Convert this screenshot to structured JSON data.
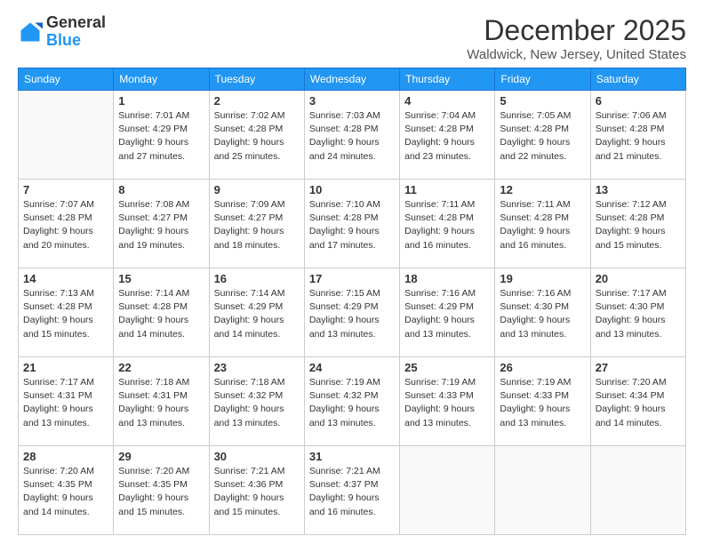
{
  "header": {
    "logo": {
      "line1": "General",
      "line2": "Blue"
    },
    "title": "December 2025",
    "location": "Waldwick, New Jersey, United States"
  },
  "days_of_week": [
    "Sunday",
    "Monday",
    "Tuesday",
    "Wednesday",
    "Thursday",
    "Friday",
    "Saturday"
  ],
  "weeks": [
    [
      {
        "num": "",
        "info": ""
      },
      {
        "num": "1",
        "info": "Sunrise: 7:01 AM\nSunset: 4:29 PM\nDaylight: 9 hours\nand 27 minutes."
      },
      {
        "num": "2",
        "info": "Sunrise: 7:02 AM\nSunset: 4:28 PM\nDaylight: 9 hours\nand 25 minutes."
      },
      {
        "num": "3",
        "info": "Sunrise: 7:03 AM\nSunset: 4:28 PM\nDaylight: 9 hours\nand 24 minutes."
      },
      {
        "num": "4",
        "info": "Sunrise: 7:04 AM\nSunset: 4:28 PM\nDaylight: 9 hours\nand 23 minutes."
      },
      {
        "num": "5",
        "info": "Sunrise: 7:05 AM\nSunset: 4:28 PM\nDaylight: 9 hours\nand 22 minutes."
      },
      {
        "num": "6",
        "info": "Sunrise: 7:06 AM\nSunset: 4:28 PM\nDaylight: 9 hours\nand 21 minutes."
      }
    ],
    [
      {
        "num": "7",
        "info": "Sunrise: 7:07 AM\nSunset: 4:28 PM\nDaylight: 9 hours\nand 20 minutes."
      },
      {
        "num": "8",
        "info": "Sunrise: 7:08 AM\nSunset: 4:27 PM\nDaylight: 9 hours\nand 19 minutes."
      },
      {
        "num": "9",
        "info": "Sunrise: 7:09 AM\nSunset: 4:27 PM\nDaylight: 9 hours\nand 18 minutes."
      },
      {
        "num": "10",
        "info": "Sunrise: 7:10 AM\nSunset: 4:28 PM\nDaylight: 9 hours\nand 17 minutes."
      },
      {
        "num": "11",
        "info": "Sunrise: 7:11 AM\nSunset: 4:28 PM\nDaylight: 9 hours\nand 16 minutes."
      },
      {
        "num": "12",
        "info": "Sunrise: 7:11 AM\nSunset: 4:28 PM\nDaylight: 9 hours\nand 16 minutes."
      },
      {
        "num": "13",
        "info": "Sunrise: 7:12 AM\nSunset: 4:28 PM\nDaylight: 9 hours\nand 15 minutes."
      }
    ],
    [
      {
        "num": "14",
        "info": "Sunrise: 7:13 AM\nSunset: 4:28 PM\nDaylight: 9 hours\nand 15 minutes."
      },
      {
        "num": "15",
        "info": "Sunrise: 7:14 AM\nSunset: 4:28 PM\nDaylight: 9 hours\nand 14 minutes."
      },
      {
        "num": "16",
        "info": "Sunrise: 7:14 AM\nSunset: 4:29 PM\nDaylight: 9 hours\nand 14 minutes."
      },
      {
        "num": "17",
        "info": "Sunrise: 7:15 AM\nSunset: 4:29 PM\nDaylight: 9 hours\nand 13 minutes."
      },
      {
        "num": "18",
        "info": "Sunrise: 7:16 AM\nSunset: 4:29 PM\nDaylight: 9 hours\nand 13 minutes."
      },
      {
        "num": "19",
        "info": "Sunrise: 7:16 AM\nSunset: 4:30 PM\nDaylight: 9 hours\nand 13 minutes."
      },
      {
        "num": "20",
        "info": "Sunrise: 7:17 AM\nSunset: 4:30 PM\nDaylight: 9 hours\nand 13 minutes."
      }
    ],
    [
      {
        "num": "21",
        "info": "Sunrise: 7:17 AM\nSunset: 4:31 PM\nDaylight: 9 hours\nand 13 minutes."
      },
      {
        "num": "22",
        "info": "Sunrise: 7:18 AM\nSunset: 4:31 PM\nDaylight: 9 hours\nand 13 minutes."
      },
      {
        "num": "23",
        "info": "Sunrise: 7:18 AM\nSunset: 4:32 PM\nDaylight: 9 hours\nand 13 minutes."
      },
      {
        "num": "24",
        "info": "Sunrise: 7:19 AM\nSunset: 4:32 PM\nDaylight: 9 hours\nand 13 minutes."
      },
      {
        "num": "25",
        "info": "Sunrise: 7:19 AM\nSunset: 4:33 PM\nDaylight: 9 hours\nand 13 minutes."
      },
      {
        "num": "26",
        "info": "Sunrise: 7:19 AM\nSunset: 4:33 PM\nDaylight: 9 hours\nand 13 minutes."
      },
      {
        "num": "27",
        "info": "Sunrise: 7:20 AM\nSunset: 4:34 PM\nDaylight: 9 hours\nand 14 minutes."
      }
    ],
    [
      {
        "num": "28",
        "info": "Sunrise: 7:20 AM\nSunset: 4:35 PM\nDaylight: 9 hours\nand 14 minutes."
      },
      {
        "num": "29",
        "info": "Sunrise: 7:20 AM\nSunset: 4:35 PM\nDaylight: 9 hours\nand 15 minutes."
      },
      {
        "num": "30",
        "info": "Sunrise: 7:21 AM\nSunset: 4:36 PM\nDaylight: 9 hours\nand 15 minutes."
      },
      {
        "num": "31",
        "info": "Sunrise: 7:21 AM\nSunset: 4:37 PM\nDaylight: 9 hours\nand 16 minutes."
      },
      {
        "num": "",
        "info": ""
      },
      {
        "num": "",
        "info": ""
      },
      {
        "num": "",
        "info": ""
      }
    ]
  ]
}
